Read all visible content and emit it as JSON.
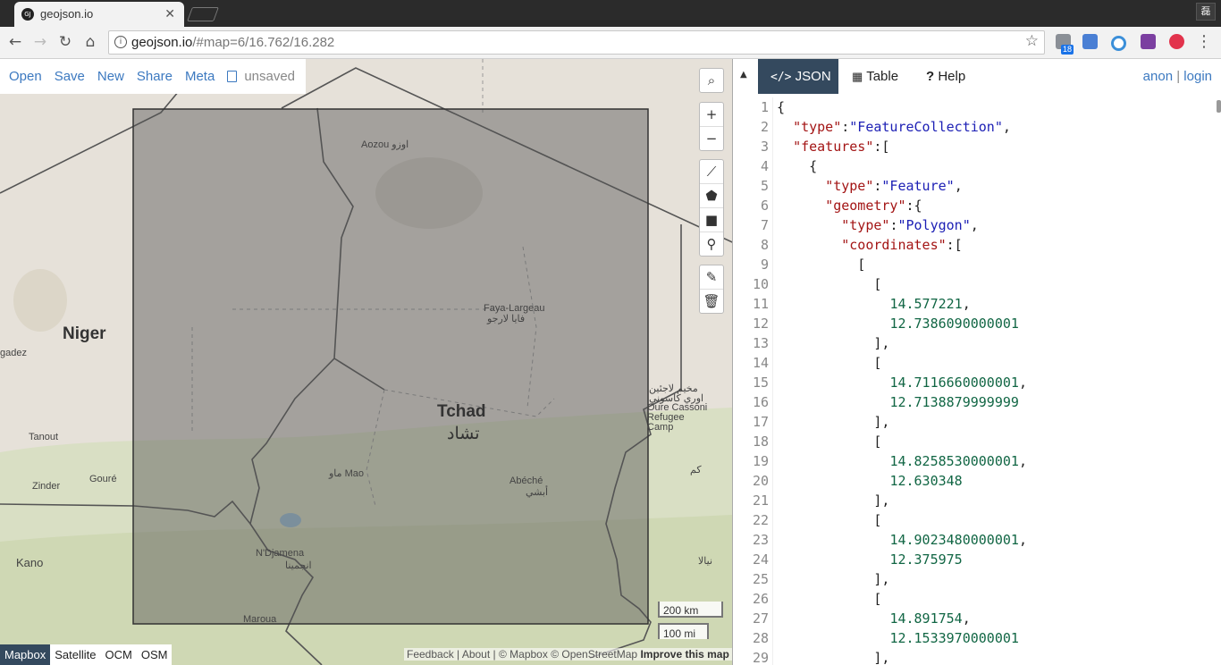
{
  "browser": {
    "tab_title": "geojson.io",
    "tab_favicon": "GJ",
    "tab_close": "✕",
    "window_button": "磊",
    "url_host": "geojson.io",
    "url_path": "/#map=6/16.762/16.282",
    "extension_badge": "18"
  },
  "menu": {
    "open": "Open",
    "save": "Save",
    "new": "New",
    "share": "Share",
    "meta": "Meta",
    "unsaved": "unsaved"
  },
  "map": {
    "labels": {
      "niger": "Niger",
      "tchad": "Tchad",
      "tchad_ar": "تشاد",
      "aozou": "Aozou اوزو",
      "faya": "Faya-Largeau",
      "faya_ar": "فايا لارجو",
      "agadez": "gadez",
      "tanout": "Tanout",
      "goure": "Gouré",
      "zinder": "Zinder",
      "kano": "Kano",
      "mao": "ماو Mao",
      "abeche": "Abéché",
      "abeche_ar": "أبشي",
      "ndjamena": "N'Djamena",
      "ndjamena_ar": "انجمينا",
      "maroua": "Maroua",
      "camp_ar1": "مخيم لاجئين",
      "camp_ar2": "اوري كاسوني",
      "camp1": "Oure Cassoni",
      "camp2": "Refugee",
      "camp3": "Camp",
      "kum": "كم",
      "nyala": "نيالا"
    },
    "controls": {
      "zoom_in": "+",
      "zoom_out": "−"
    },
    "scale_km": "200 km",
    "scale_mi": "100 mi",
    "layers": [
      "Mapbox",
      "Satellite",
      "OCM",
      "OSM"
    ],
    "active_layer": "Mapbox",
    "attribution": {
      "feedback": "Feedback",
      "sep1": " | ",
      "about": "About",
      "sep2": " | © ",
      "mapbox": "Mapbox",
      "sep3": " © ",
      "osm": "OpenStreetMap",
      "improve": "Improve this map"
    }
  },
  "panel": {
    "tabs": {
      "json": "JSON",
      "table": "Table",
      "help": "Help"
    },
    "auth": {
      "anon": "anon",
      "sep": "|",
      "login": "login"
    },
    "lines": [
      "{",
      "  \"type\":\"FeatureCollection\",",
      "  \"features\":[",
      "    {",
      "      \"type\":\"Feature\",",
      "      \"geometry\":{",
      "        \"type\":\"Polygon\",",
      "        \"coordinates\":[",
      "          [",
      "            [",
      "              14.577221,",
      "              12.7386090000001",
      "            ],",
      "            [",
      "              14.7116660000001,",
      "              12.7138879999999",
      "            ],",
      "            [",
      "              14.8258530000001,",
      "              12.630348",
      "            ],",
      "            [",
      "              14.9023480000001,",
      "              12.375975",
      "            ],",
      "            [",
      "              14.891754,",
      "              12.1533970000001",
      "            ],"
    ]
  }
}
